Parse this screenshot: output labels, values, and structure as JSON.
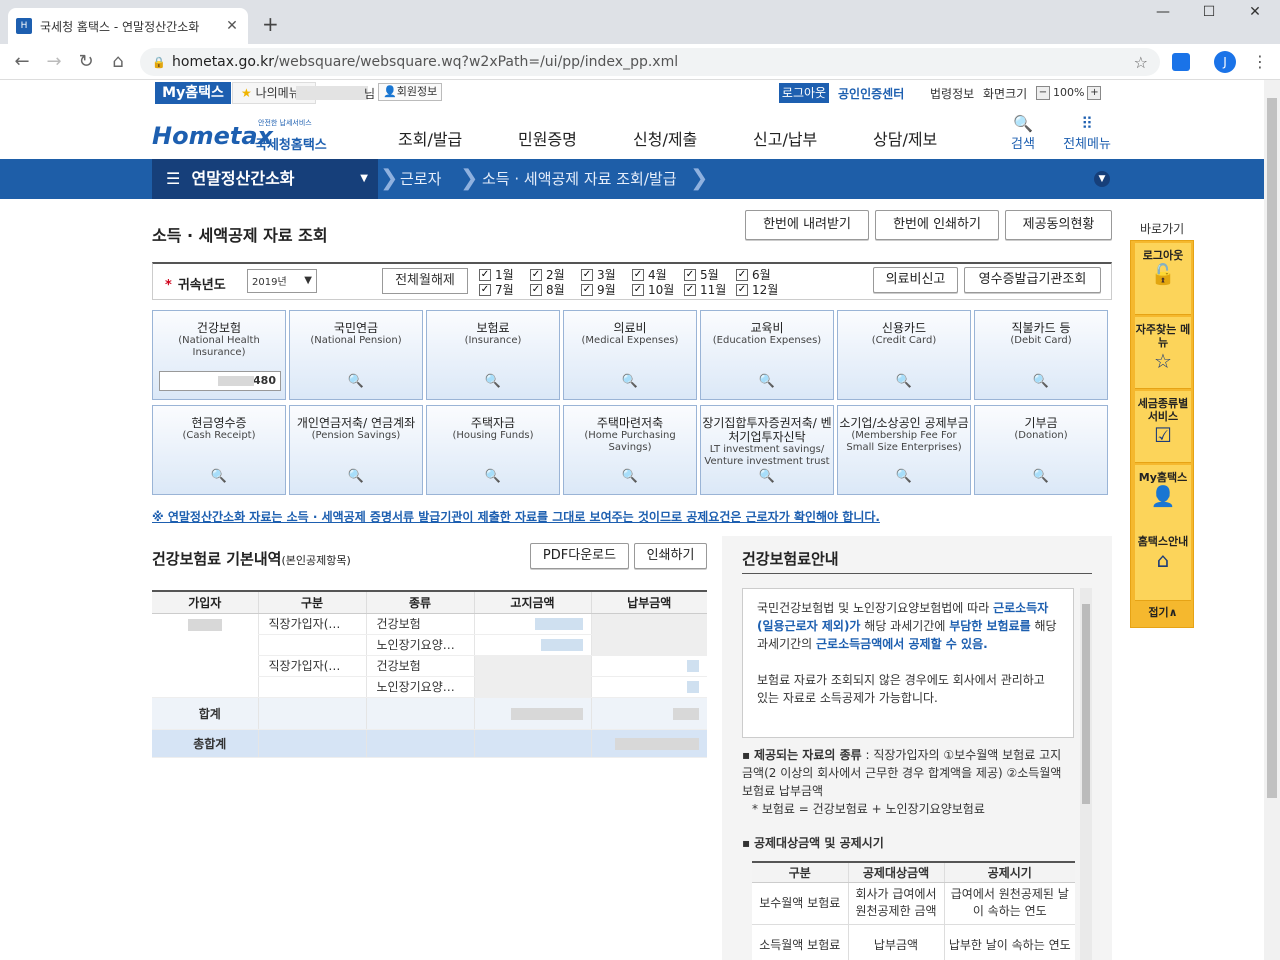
{
  "browser": {
    "tab_title": "국세청 홈택스 - 연말정산간소화",
    "url_host": "hometax.go.kr",
    "url_path": "/websquare/websquare.wq?w2xPath=/ui/pp/index_pp.xml",
    "profile_initial": "J"
  },
  "util": {
    "my_hometax": "My홈택스",
    "my_menu": "나의메뉴",
    "name_suffix": "님",
    "member_info": "회원정보",
    "logout": "로그아웃",
    "cert_center": "공인인증센터",
    "law_info": "법령정보",
    "screen_size": "화면크기",
    "zoom": "100%"
  },
  "header": {
    "logo_small": "안전한 납세서비스",
    "logo_en": "Hometax",
    "logo_kr": "국세청홈택스",
    "gnb": [
      "조회/발급",
      "민원증명",
      "신청/제출",
      "신고/납부",
      "상담/제보"
    ],
    "search": "검색",
    "all_menu": "전체메뉴"
  },
  "nav": {
    "section": "연말정산간소화",
    "crumbs": [
      "근로자",
      "소득 · 세액공제 자료 조회/발급"
    ]
  },
  "page": {
    "title": "소득 · 세액공제 자료 조회",
    "btn_download_all": "한번에 내려받기",
    "btn_print_all": "한번에 인쇄하기",
    "btn_consent": "제공동의현황"
  },
  "filter": {
    "year_label": "귀속년도",
    "year_value": "2019년",
    "clear_all": "전체월해제",
    "months": [
      "1월",
      "2월",
      "3월",
      "4월",
      "5월",
      "6월",
      "7월",
      "8월",
      "9월",
      "10월",
      "11월",
      "12월"
    ],
    "medical_report": "의료비신고",
    "receipt_org": "영수증발급기관조회"
  },
  "tiles": [
    {
      "k": "건강보험",
      "e": "(National Health Insurance)",
      "v": "480"
    },
    {
      "k": "국민연금",
      "e": "(National Pension)"
    },
    {
      "k": "보험료",
      "e": "(Insurance)"
    },
    {
      "k": "의료비",
      "e": "(Medical Expenses)"
    },
    {
      "k": "교육비",
      "e": "(Education Expenses)"
    },
    {
      "k": "신용카드",
      "e": "(Credit Card)"
    },
    {
      "k": "직불카드 등",
      "e": "(Debit Card)"
    },
    {
      "k": "현금영수증",
      "e": "(Cash Receipt)"
    },
    {
      "k": "개인연금저축/ 연금계좌",
      "e": "(Pension Savings)"
    },
    {
      "k": "주택자금",
      "e": "(Housing Funds)"
    },
    {
      "k": "주택마련저축",
      "e": "(Home Purchasing Savings)"
    },
    {
      "k": "장기집합투자증권저축/ 벤처기업투자신탁",
      "e": "LT investment savings/ Venture investment trust"
    },
    {
      "k": "소기업/소상공인 공제부금",
      "e": "(Membership Fee For Small Size Enterprises)"
    },
    {
      "k": "기부금",
      "e": "(Donation)"
    }
  ],
  "notice": "※ 연말정산간소화 자료는 소득 · 세액공제 증명서류 발급기관이 제출한 자료를 그대로 보여주는 것이므로 공제요건은 근로자가 확인해야 합니다.",
  "left": {
    "title": "건강보험료 기본내역",
    "title_sub": "(본인공제항목)",
    "btn_pdf": "PDF다운로드",
    "btn_print": "인쇄하기",
    "columns": [
      "가입자",
      "구분",
      "종류",
      "고지금액",
      "납부금액"
    ],
    "rows": [
      {
        "type": "직장가입자(…",
        "kind": "건강보험"
      },
      {
        "type": "",
        "kind": "노인장기요양…"
      },
      {
        "type": "직장가입자(…",
        "kind": "건강보험"
      },
      {
        "type": "",
        "kind": "노인장기요양…"
      }
    ],
    "sum": "합계",
    "total": "총합계"
  },
  "guide": {
    "title": "건강보험료안내",
    "box_p1_a": "국민건강보험법 및 노인장기요양보험법에 따라 ",
    "box_p1_b": "근로소득자(일용근로자 제외)가",
    "box_p1_c": " 해당 과세기간에 ",
    "box_p1_d": "부담한 보험료를",
    "box_p1_e": " 해당 과세기간의 ",
    "box_p1_f": "근로소득금액에서 공제할 수 있음.",
    "box_p2": "보험료 자료가 조회되지 않은 경우에도 회사에서 관리하고 있는 자료로 소득공제가 가능합니다.",
    "b1_head": "제공되는 자료의 종류",
    "b1_body": " : 직장가입자의 ①보수월액 보험료 고지금액(2 이상의 회사에서 근무한 경우 합계액을 제공) ②소득월액 보험료 납부금액",
    "b1_note": "* 보험료 = 건강보험료 + 노인장기요양보험료",
    "b2_head": "공제대상금액 및 공제시기",
    "sub_cols": [
      "구분",
      "공제대상금액",
      "공제시기"
    ],
    "sub_rows": [
      [
        "보수월액 보험료",
        "회사가 급여에서 원천공제한 금액",
        "급여에서 원천공제된 날이 속하는 연도"
      ],
      [
        "소득월액 보험료",
        "납부금액",
        "납부한 날이 속하는 연도"
      ]
    ]
  },
  "quick": {
    "title": "바로가기",
    "items": [
      "로그아웃",
      "자주찾는 메뉴",
      "세금종류별 서비스",
      "My홈택스",
      "홈택스안내"
    ],
    "fold": "접기∧"
  }
}
